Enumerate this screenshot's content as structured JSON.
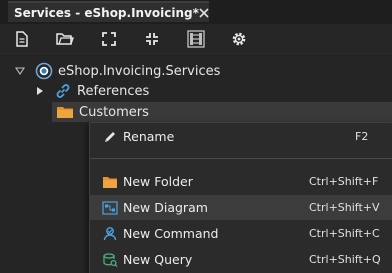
{
  "tab": {
    "title": "Services - eShop.Invoicing*"
  },
  "toolbar": {
    "buttons": [
      "new-document-icon",
      "open-folder-icon",
      "expand-icon",
      "collapse-icon",
      "diagram-view-icon",
      "settings-icon"
    ]
  },
  "tree": {
    "root": {
      "label": "eShop.Invoicing.Services",
      "expanded": true
    },
    "items": [
      {
        "label": "References",
        "expanded": false
      },
      {
        "label": "Customers",
        "selected": true
      }
    ]
  },
  "context_menu": {
    "items": [
      {
        "label": "Rename",
        "shortcut": "F2",
        "icon": "pencil-icon"
      },
      {
        "label": "New Folder",
        "shortcut": "Ctrl+Shift+F",
        "icon": "folder-icon"
      },
      {
        "label": "New Diagram",
        "shortcut": "Ctrl+Shift+V",
        "icon": "diagram-icon",
        "hovered": true
      },
      {
        "label": "New Command",
        "shortcut": "Ctrl+Shift+C",
        "icon": "command-icon"
      },
      {
        "label": "New Query",
        "shortcut": "Ctrl+Shift+Q",
        "icon": "query-icon"
      }
    ]
  },
  "colors": {
    "background": "#252525",
    "folder": "#e8912d",
    "accent_blue": "#4aa3df",
    "query_green": "#4caf80"
  }
}
